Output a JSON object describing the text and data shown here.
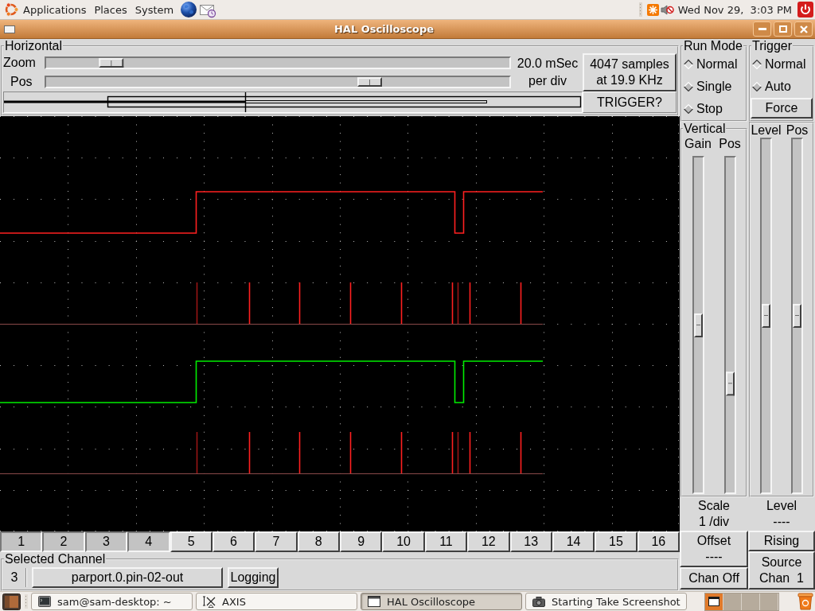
{
  "top_panel": {
    "menus": [
      "Applications",
      "Places",
      "System"
    ],
    "clock": "Wed Nov 29,  3:03 PM"
  },
  "window": {
    "title": "HAL Oscilloscope"
  },
  "horizontal": {
    "title": "Horizontal",
    "zoom": {
      "label": "Zoom",
      "level": 0.12
    },
    "pos": {
      "label": "Pos",
      "level": 0.71
    },
    "time_per_div": [
      "20.0 mSec",
      "per div"
    ],
    "samples_button": [
      "4047 samples",
      "at 19.9 KHz"
    ],
    "trigger_status": "TRIGGER?"
  },
  "run_mode": {
    "title": "Run Mode",
    "options": [
      {
        "label": "Normal",
        "selected": true
      },
      {
        "label": "Single",
        "selected": false
      },
      {
        "label": "Stop",
        "selected": false
      }
    ]
  },
  "trigger": {
    "title": "Trigger",
    "options": [
      {
        "label": "Normal",
        "selected": true
      },
      {
        "label": "Auto",
        "selected": false
      }
    ],
    "force_button": "Force",
    "sliders": [
      {
        "label": "Level",
        "level": 0.5
      },
      {
        "label": "Pos",
        "level": 0.5
      }
    ],
    "level_readout": [
      "Level",
      "----"
    ],
    "edge_button": "Rising",
    "source_button": [
      "Source",
      "Chan  1"
    ]
  },
  "vertical": {
    "title": "Vertical",
    "sliders": [
      {
        "label": "Gain",
        "level": 0.5
      },
      {
        "label": "Pos",
        "level": 0.31
      }
    ],
    "scale": [
      "Scale",
      "1 /div"
    ],
    "offset_button": [
      "Offset",
      "----"
    ],
    "chan_off_button": "Chan Off"
  },
  "channels": [
    {
      "label": "1",
      "on": true
    },
    {
      "label": "2",
      "on": true
    },
    {
      "label": "3",
      "on": true
    },
    {
      "label": "4",
      "on": true
    },
    {
      "label": "5",
      "on": false
    },
    {
      "label": "6",
      "on": false
    },
    {
      "label": "7",
      "on": false
    },
    {
      "label": "8",
      "on": false
    },
    {
      "label": "9",
      "on": false
    },
    {
      "label": "10",
      "on": false
    },
    {
      "label": "11",
      "on": false
    },
    {
      "label": "12",
      "on": false
    },
    {
      "label": "13",
      "on": false
    },
    {
      "label": "14",
      "on": false
    },
    {
      "label": "15",
      "on": false
    },
    {
      "label": "16",
      "on": false
    }
  ],
  "selected_channel": {
    "title": "Selected Channel",
    "number": "3",
    "name_button": "parport.0.pin-02-out",
    "logging_button": "Logging"
  },
  "taskbar": {
    "tasks": [
      {
        "label": "sam@sam-desktop: ~",
        "kind": "terminal",
        "selected": false
      },
      {
        "label": "AXIS",
        "kind": "axis",
        "selected": false
      },
      {
        "label": "HAL Oscilloscope",
        "kind": "window",
        "selected": true
      },
      {
        "label": "Starting Take Screenshot",
        "kind": "camera",
        "selected": false
      }
    ],
    "workspaces": [
      {
        "selected": true
      },
      {
        "selected": false
      },
      {
        "selected": false
      },
      {
        "selected": false
      }
    ]
  }
}
